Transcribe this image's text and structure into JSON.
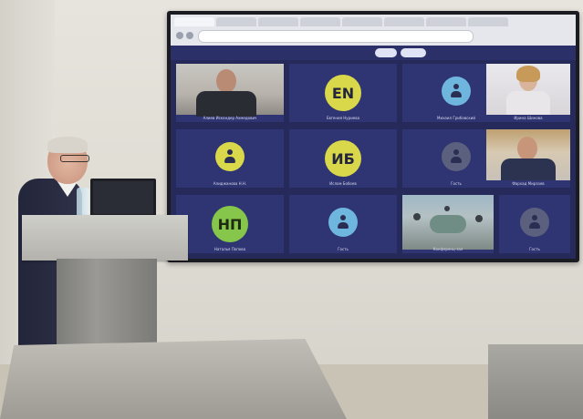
{
  "meeting": {
    "participants": [
      {
        "name": "Алиев Искандер Ахмедович",
        "type": "video"
      },
      {
        "name": "Евгения Нуриева",
        "initials": "EN",
        "type": "avatar",
        "color": "#d9d84a"
      },
      {
        "name": "Михаил Грибовский",
        "type": "icon",
        "color": "#6fb6de"
      },
      {
        "name": "Ирина Шинова",
        "type": "video"
      },
      {
        "name": "Алиджанова Н.Н.",
        "type": "icon",
        "color": "#d9d84a"
      },
      {
        "name": "Ислом Бобоев",
        "initials": "ИБ",
        "type": "avatar",
        "color": "#d9d84a"
      },
      {
        "name": "Гость",
        "type": "icon",
        "color": "#5b607f"
      },
      {
        "name": "Фархад Мирзаев",
        "type": "video"
      },
      {
        "name": "Наталья Попова",
        "initials": "НП",
        "type": "avatar",
        "color": "#86c64a"
      },
      {
        "name": "Гость",
        "type": "icon",
        "color": "#6fb6de"
      },
      {
        "name": "Конференц-зал",
        "type": "video"
      },
      {
        "name": "Гость",
        "type": "icon",
        "color": "#5b607f"
      }
    ]
  }
}
